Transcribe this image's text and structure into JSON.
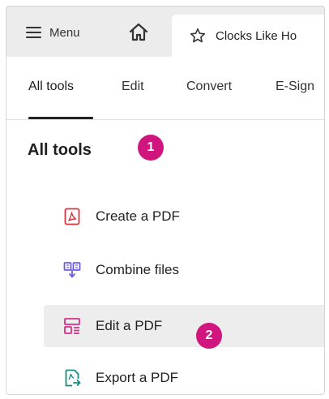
{
  "topbar": {
    "menu_label": "Menu",
    "home_icon": "home-icon",
    "active_tab_title": "Clocks Like Ho",
    "tab_icon": "star-icon"
  },
  "navtabs": [
    {
      "label": "All tools",
      "active": true
    },
    {
      "label": "Edit",
      "active": false
    },
    {
      "label": "Convert",
      "active": false
    },
    {
      "label": "E-Sign",
      "active": false
    }
  ],
  "section": {
    "title": "All tools"
  },
  "callouts": {
    "badge_1": "1",
    "badge_2": "2"
  },
  "tools": [
    {
      "label": "Create a PDF",
      "icon": "create-pdf-icon",
      "color": "#d7373f"
    },
    {
      "label": "Combine files",
      "icon": "combine-files-icon",
      "color": "#6e5be0"
    },
    {
      "label": "Edit a PDF",
      "icon": "edit-pdf-icon",
      "color": "#d92d8a",
      "hovered": true
    },
    {
      "label": "Export a PDF",
      "icon": "export-pdf-icon",
      "color": "#128c7e"
    }
  ],
  "colors": {
    "badge": "#d1157f",
    "topbar_bg": "#ececec",
    "hover_bg": "#ededed"
  }
}
